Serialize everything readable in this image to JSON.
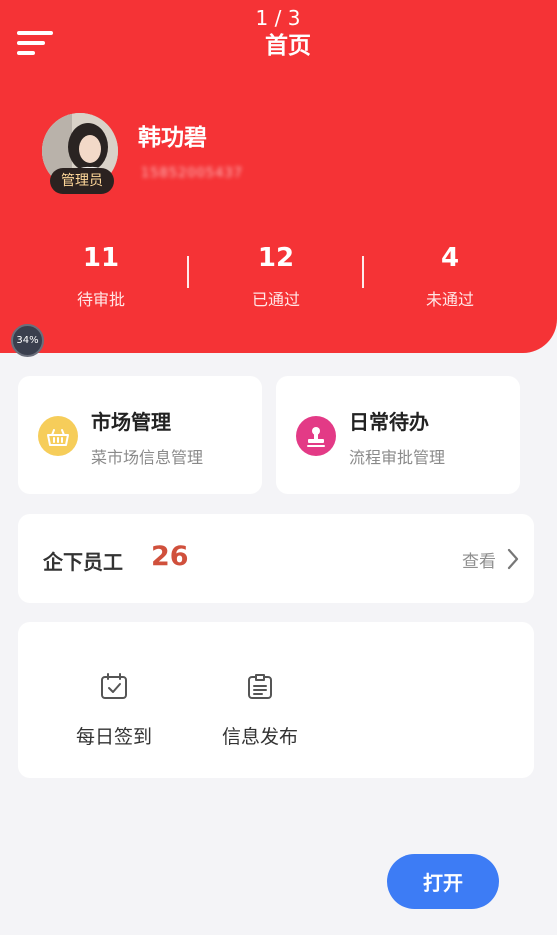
{
  "header": {
    "page_indicator": "1 / 3",
    "title": "首页",
    "background_color": "#f53336"
  },
  "user": {
    "name": "韩功碧",
    "phone": "15852005437",
    "role_badge": "管理员"
  },
  "stats": [
    {
      "value": "11",
      "label": "待审批"
    },
    {
      "value": "12",
      "label": "已通过"
    },
    {
      "value": "4",
      "label": "未通过"
    }
  ],
  "progress_badge": "34%",
  "features": [
    {
      "title": "市场管理",
      "subtitle": "菜市场信息管理",
      "icon": "basket-icon",
      "icon_color": "#f6cd5a"
    },
    {
      "title": "日常待办",
      "subtitle": "流程审批管理",
      "icon": "stamp-icon",
      "icon_color": "#e33a86"
    }
  ],
  "staff": {
    "label": "企下员工",
    "count": "26",
    "view_label": "查看"
  },
  "tools": [
    {
      "label": "每日签到",
      "icon": "calendar-check-icon"
    },
    {
      "label": "信息发布",
      "icon": "clipboard-icon"
    }
  ],
  "open_button": {
    "label": "打开",
    "color": "#3d7cf5"
  }
}
